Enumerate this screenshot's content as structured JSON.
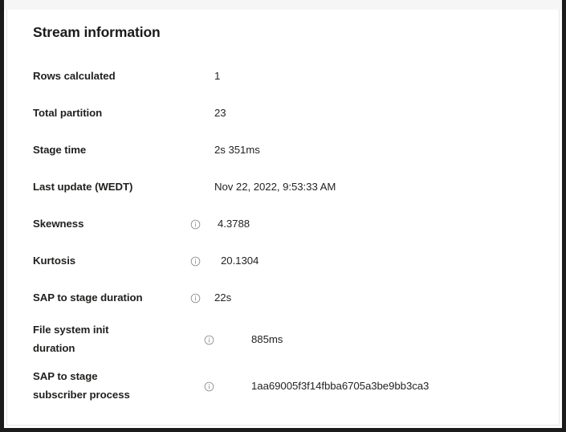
{
  "card": {
    "title": "Stream information"
  },
  "icons": {
    "info": "info-circle-icon"
  },
  "rows": [
    {
      "label": "Rows calculated",
      "value": "1",
      "has_info": false
    },
    {
      "label": "Total partition",
      "value": "23",
      "has_info": false
    },
    {
      "label": "Stage time",
      "value": "2s 351ms",
      "has_info": false
    },
    {
      "label": "Last update (WEDT)",
      "value": "Nov 22, 2022, 9:53:33 AM",
      "has_info": false
    },
    {
      "label": "Skewness",
      "value": "4.3788",
      "has_info": true
    },
    {
      "label": "Kurtosis",
      "value": "20.1304",
      "has_info": true
    },
    {
      "label": "SAP to stage duration",
      "value": "22s",
      "has_info": true
    },
    {
      "label": "File system init duration",
      "value": "885ms",
      "has_info": true
    },
    {
      "label": "SAP to stage subscriber process",
      "value": "1aa69005f3f14fbba6705a3be9bb3ca3",
      "has_info": true
    }
  ],
  "colors": {
    "card_background": "#ffffff",
    "card_border": "#e6e6e6",
    "outer_frame": "#1b1b1b",
    "top_strip": "#f6f6f6",
    "label_text": "#201f1e",
    "value_text": "#242322",
    "title_text": "#1b1a19",
    "icon": "#8a8886"
  }
}
